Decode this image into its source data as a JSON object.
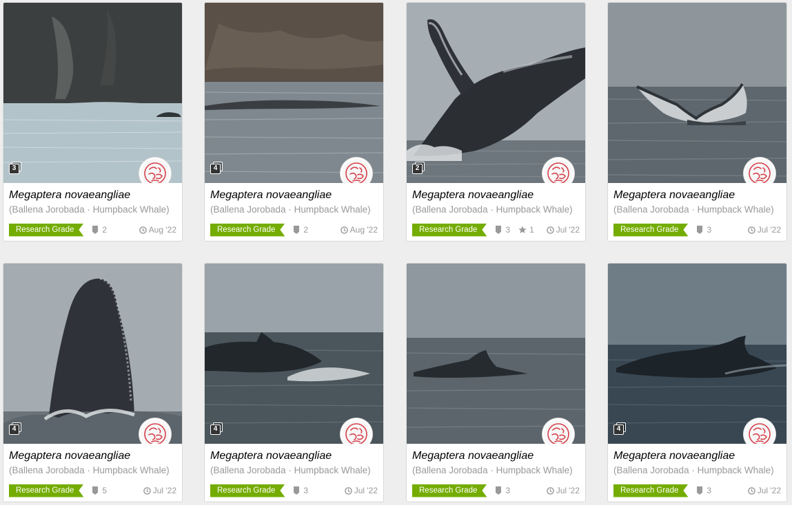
{
  "observations": [
    {
      "scientific_name": "Megaptera novaeangliae",
      "common_name": "(Ballena Jorobada · Humpback Whale)",
      "quality_grade": "Research Grade",
      "photo_count": "3",
      "identifications": "2",
      "faves": "",
      "date": "Aug '22",
      "scene": "cliff-distant"
    },
    {
      "scientific_name": "Megaptera novaeangliae",
      "common_name": "(Ballena Jorobada · Humpback Whale)",
      "quality_grade": "Research Grade",
      "photo_count": "4",
      "identifications": "2",
      "faves": "",
      "date": "Aug '22",
      "scene": "cliff-back"
    },
    {
      "scientific_name": "Megaptera novaeangliae",
      "common_name": "(Ballena Jorobada · Humpback Whale)",
      "quality_grade": "Research Grade",
      "photo_count": "2",
      "identifications": "3",
      "faves": "1",
      "date": "Jul '22",
      "scene": "breach"
    },
    {
      "scientific_name": "Megaptera novaeangliae",
      "common_name": "(Ballena Jorobada · Humpback Whale)",
      "quality_grade": "Research Grade",
      "photo_count": "",
      "identifications": "3",
      "faves": "",
      "date": "Jul '22",
      "scene": "fluke"
    },
    {
      "scientific_name": "Megaptera novaeangliae",
      "common_name": "(Ballena Jorobada · Humpback Whale)",
      "quality_grade": "Research Grade",
      "photo_count": "4",
      "identifications": "5",
      "faves": "",
      "date": "Jul '22",
      "scene": "spyhop"
    },
    {
      "scientific_name": "Megaptera novaeangliae",
      "common_name": "(Ballena Jorobada · Humpback Whale)",
      "quality_grade": "Research Grade",
      "photo_count": "4",
      "identifications": "3",
      "faves": "",
      "date": "Jul '22",
      "scene": "dorsal-near"
    },
    {
      "scientific_name": "Megaptera novaeangliae",
      "common_name": "(Ballena Jorobada · Humpback Whale)",
      "quality_grade": "Research Grade",
      "photo_count": "",
      "identifications": "3",
      "faves": "",
      "date": "Jul '22",
      "scene": "dorsal-far"
    },
    {
      "scientific_name": "Megaptera novaeangliae",
      "common_name": "(Ballena Jorobada · Humpback Whale)",
      "quality_grade": "Research Grade",
      "photo_count": "4",
      "identifications": "3",
      "faves": "",
      "date": "Jul '22",
      "scene": "dorsal-dark"
    }
  ],
  "icons": {
    "identification": "identification-icon",
    "fave": "star-icon",
    "date": "clock-icon",
    "photo_count": "photos-stack-icon",
    "user": "user-avatar-icon"
  },
  "colors": {
    "research_grade": "#74ac00",
    "muted_text": "#999999",
    "avatar_mark": "#d6404a"
  }
}
